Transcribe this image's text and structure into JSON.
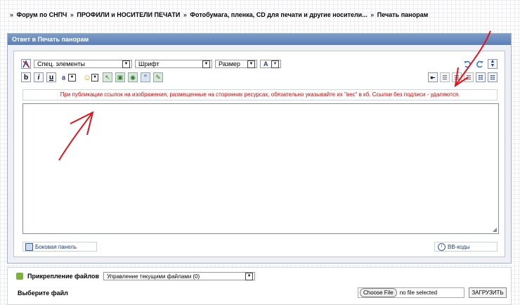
{
  "breadcrumb": {
    "prefix": "»",
    "items": [
      "Форум по СНПЧ",
      "ПРОФИЛИ и НОСИТЕЛИ ПЕЧАТИ",
      "Фотобумага, пленка, CD для печати и другие носители...",
      "Печать панорам"
    ],
    "separator": "»"
  },
  "panel": {
    "title": "Ответ в Печать панорам"
  },
  "toolbar": {
    "special_select": "Спец. элементы",
    "font_select": "Шрифт",
    "size_select": "Размер",
    "color_label": "A",
    "bold": "b",
    "italic": "i",
    "underline": "u",
    "align_label": "a̲",
    "smiley": "☺"
  },
  "notice": "При публикации ссылок на изображения, размещенные на сторонних ресурсах, обязательно указывайте их \"вес\" в кб. Ссылки без подписи - удаляются.",
  "message": {
    "value": ""
  },
  "side_panel": {
    "label": "Боковая панель"
  },
  "bbcodes": {
    "label": "BB-коды"
  },
  "attachments": {
    "title": "Прикрепление файлов",
    "manage_select": "Управление текущими файлами (0)",
    "choose_label": "Выберите файл",
    "choose_button": "Choose File",
    "no_file": "no file selected",
    "upload_button": "ЗАГРУЗИТЬ"
  },
  "colors": {
    "header": "#5b7fb6",
    "notice": "#d60000",
    "annotation": "#e0141b"
  }
}
